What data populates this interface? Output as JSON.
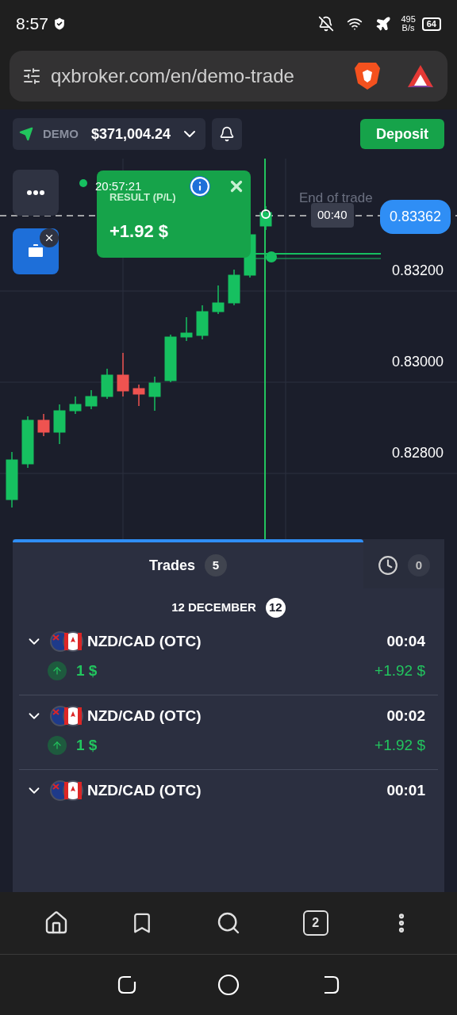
{
  "status_bar": {
    "time": "8:57",
    "network_speed": "495",
    "network_speed_unit": "B/s",
    "battery": "64"
  },
  "browser": {
    "url": "qxbroker.com/en/demo-trade",
    "tab_count": "2"
  },
  "account": {
    "mode": "DEMO",
    "balance": "$371,004.24",
    "deposit_label": "Deposit"
  },
  "chart": {
    "time": "20:57:21",
    "result_label": "RESULT (P/L)",
    "result_value": "+1.92 $",
    "end_label": "End of trade",
    "countdown": "00:40",
    "current_price": "0.83362",
    "price_labels": [
      "0.83200",
      "0.83000",
      "0.82800"
    ]
  },
  "trades_panel": {
    "tabs": [
      {
        "kind": "trades",
        "label": "Trades",
        "count": "5",
        "selected": true
      },
      {
        "kind": "pending",
        "count": "0",
        "selected": false
      }
    ],
    "date": "12 DECEMBER",
    "date_count": "12",
    "trades": [
      {
        "pair": "NZD/CAD (OTC)",
        "time": "00:04",
        "amount": "1 $",
        "profit": "+1.92 $"
      },
      {
        "pair": "NZD/CAD (OTC)",
        "time": "00:02",
        "amount": "1 $",
        "profit": "+1.92 $"
      },
      {
        "pair": "NZD/CAD (OTC)",
        "time": "00:01"
      }
    ]
  }
}
